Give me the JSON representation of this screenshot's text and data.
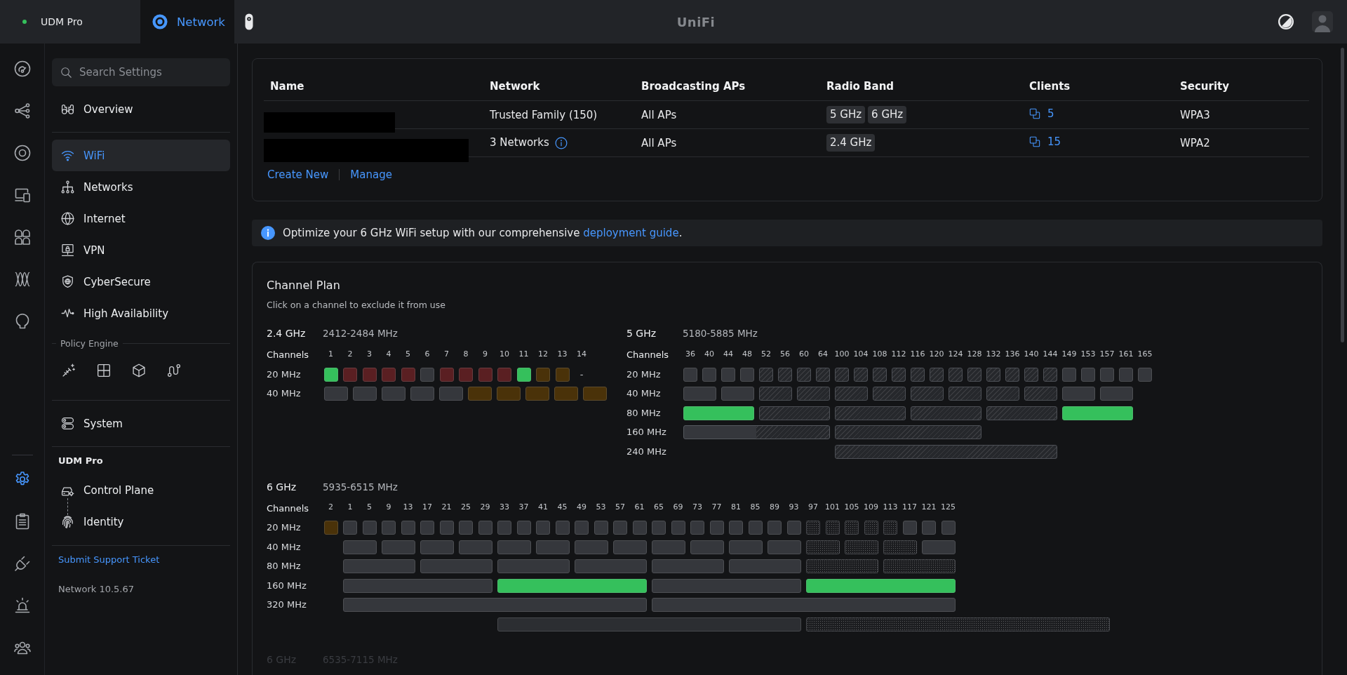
{
  "topbar": {
    "tabs": [
      {
        "kind": "device",
        "label": "UDM Pro",
        "selected": false
      },
      {
        "kind": "app",
        "label": "Network",
        "selected": true
      }
    ],
    "logo": "UniFi"
  },
  "rail": {
    "top": [
      {
        "selected": false
      },
      {
        "selected": false
      },
      {
        "selected": false
      },
      {
        "selected": false
      },
      {
        "selected": false
      },
      {
        "selected": false
      },
      {
        "selected": false
      }
    ],
    "bottom": [
      {
        "selected": true
      },
      {
        "selected": false
      },
      {
        "selected": false
      },
      {
        "selected": false
      },
      {
        "selected": false
      }
    ]
  },
  "sidebar": {
    "search": {
      "placeholder": "Search Settings"
    },
    "sections": [
      {
        "kind": "nav",
        "items": [
          {
            "label": "Overview",
            "selected": false
          }
        ]
      },
      {
        "kind": "nav",
        "items": [
          {
            "label": "WiFi",
            "selected": true
          },
          {
            "label": "Networks",
            "selected": false
          },
          {
            "label": "Internet",
            "selected": false
          },
          {
            "label": "VPN",
            "selected": false
          },
          {
            "label": "CyberSecure",
            "selected": false
          },
          {
            "label": "High Availability",
            "selected": false
          }
        ]
      },
      {
        "kind": "tools",
        "title": "Policy Engine",
        "tools": [
          {
            "selected": false
          },
          {
            "selected": false
          },
          {
            "selected": false
          },
          {
            "selected": false
          }
        ]
      },
      {
        "kind": "nav",
        "items": [
          {
            "label": "System",
            "selected": false
          }
        ]
      },
      {
        "kind": "device",
        "title": "UDM Pro",
        "items": [
          {
            "label": "Control Plane",
            "selected": false
          },
          {
            "label": "Identity",
            "selected": false
          }
        ]
      }
    ],
    "support_link": "Submit Support Ticket",
    "version": "Network 10.5.67"
  },
  "wifi_networks": {
    "columns": [
      "Name",
      "Network",
      "Broadcasting APs",
      "Radio Band",
      "Clients",
      "Security"
    ],
    "rows": [
      {
        "redacted": true,
        "network": "Trusted Family (150)",
        "info": false,
        "broadcasting_aps": "All APs",
        "radio_bands": [
          "5 GHz",
          "6 GHz"
        ],
        "clients": "5",
        "security": "WPA3"
      },
      {
        "redacted": true,
        "network": "3 Networks",
        "info": true,
        "broadcasting_aps": "All APs",
        "radio_bands": [
          "2.4 GHz"
        ],
        "clients": "15",
        "security": "WPA2"
      }
    ],
    "actions": [
      "Create New",
      "Manage"
    ]
  },
  "banner": {
    "text": "Optimize your 6 GHz WiFi setup with our comprehensive ",
    "link": "deployment guide",
    "tail": "."
  },
  "channel_plan": {
    "title": "Channel Plan",
    "subtitle": "Click on a channel to exclude it from use",
    "bands": [
      {
        "name": "2.4 GHz",
        "range": "2412-2484 MHz",
        "dimmed": false,
        "channels_label": "Channels",
        "channels": [
          "1",
          "2",
          "3",
          "4",
          "5",
          "6",
          "7",
          "8",
          "9",
          "10",
          "11",
          "12",
          "13",
          "14"
        ],
        "rows": [
          {
            "label": "20 MHz",
            "cells": [
              {
                "kind": "plain",
                "color": "#35c05c"
              },
              {
                "kind": "plain",
                "color": "#5a1f22"
              },
              {
                "kind": "plain",
                "color": "#5a1f22"
              },
              {
                "kind": "plain",
                "color": "#5a1f22"
              },
              {
                "kind": "plain",
                "color": "#5a1f22"
              },
              {
                "kind": "plain",
                "color": "#35373c"
              },
              {
                "kind": "plain",
                "color": "#5a1f22"
              },
              {
                "kind": "plain",
                "color": "#5a1f22"
              },
              {
                "kind": "plain",
                "color": "#5a1f22"
              },
              {
                "kind": "plain",
                "color": "#5a1f22"
              },
              {
                "kind": "plain",
                "color": "#35c05c"
              },
              {
                "kind": "plain",
                "color": "#4a3209"
              },
              {
                "kind": "plain",
                "color": "#4a3209"
              },
              {
                "kind": "text",
                "text": "-"
              }
            ]
          },
          {
            "label": "40 MHz",
            "cells": [
              {
                "kind": "plain",
                "color": "#35373c"
              },
              {
                "kind": "plain",
                "color": "#35373c"
              },
              {
                "kind": "plain",
                "color": "#35373c"
              },
              {
                "kind": "plain",
                "color": "#35373c"
              },
              {
                "kind": "plain",
                "color": "#35373c"
              },
              {
                "kind": "plain",
                "color": "#4a3209"
              },
              {
                "kind": "plain",
                "color": "#4a3209"
              },
              {
                "kind": "plain",
                "color": "#4a3209"
              },
              {
                "kind": "plain",
                "color": "#4a3209"
              },
              {
                "kind": "plain",
                "color": "#4a3209"
              }
            ]
          }
        ]
      },
      {
        "name": "5 GHz",
        "range": "5180-5885 MHz",
        "dimmed": false,
        "channels_label": "Channels",
        "channels": [
          "36",
          "40",
          "44",
          "48",
          "52",
          "56",
          "60",
          "64",
          "100",
          "104",
          "108",
          "112",
          "116",
          "120",
          "124",
          "128",
          "132",
          "136",
          "140",
          "144",
          "149",
          "153",
          "157",
          "161",
          "165"
        ],
        "rows": [
          {
            "label": "20 MHz",
            "cells": [
              {
                "kind": "plain",
                "color": "#35373c"
              },
              {
                "kind": "plain",
                "color": "#35373c"
              },
              {
                "kind": "plain",
                "color": "#35373c"
              },
              {
                "kind": "plain",
                "color": "#35373c"
              },
              {
                "kind": "hatched",
                "color": "#26282c"
              },
              {
                "kind": "hatched",
                "color": "#26282c"
              },
              {
                "kind": "hatched",
                "color": "#26282c"
              },
              {
                "kind": "hatched",
                "color": "#26282c"
              },
              {
                "kind": "hatched",
                "color": "#26282c"
              },
              {
                "kind": "hatched",
                "color": "#26282c"
              },
              {
                "kind": "hatched",
                "color": "#26282c"
              },
              {
                "kind": "hatched",
                "color": "#26282c"
              },
              {
                "kind": "hatched",
                "color": "#26282c"
              },
              {
                "kind": "hatched",
                "color": "#26282c"
              },
              {
                "kind": "hatched",
                "color": "#26282c"
              },
              {
                "kind": "hatched",
                "color": "#26282c"
              },
              {
                "kind": "hatched",
                "color": "#26282c"
              },
              {
                "kind": "hatched",
                "color": "#26282c"
              },
              {
                "kind": "hatched",
                "color": "#26282c"
              },
              {
                "kind": "hatched",
                "color": "#26282c"
              },
              {
                "kind": "plain",
                "color": "#35373c"
              },
              {
                "kind": "plain",
                "color": "#35373c"
              },
              {
                "kind": "plain",
                "color": "#35373c"
              },
              {
                "kind": "plain",
                "color": "#35373c"
              },
              {
                "kind": "plain",
                "color": "#35373c"
              }
            ]
          },
          {
            "label": "40 MHz",
            "cells": [
              {
                "kind": "plain",
                "color": "#35373c"
              },
              {
                "kind": "plain",
                "color": "#35373c"
              },
              {
                "kind": "hatched",
                "color": "#26282c"
              },
              {
                "kind": "hatched",
                "color": "#26282c"
              },
              {
                "kind": "hatched",
                "color": "#26282c"
              },
              {
                "kind": "hatched",
                "color": "#26282c"
              },
              {
                "kind": "hatched",
                "color": "#26282c"
              },
              {
                "kind": "hatched",
                "color": "#26282c"
              },
              {
                "kind": "hatched",
                "color": "#26282c"
              },
              {
                "kind": "hatched",
                "color": "#26282c"
              },
              {
                "kind": "plain",
                "color": "#35373c"
              },
              {
                "kind": "plain",
                "color": "#35373c"
              }
            ]
          },
          {
            "label": "80 MHz",
            "cells": [
              {
                "kind": "plain",
                "color": "#35c05c"
              },
              {
                "kind": "hatched",
                "color": "#26282c"
              },
              {
                "kind": "hatched",
                "color": "#26282c"
              },
              {
                "kind": "hatched",
                "color": "#26282c"
              },
              {
                "kind": "hatched",
                "color": "#26282c"
              },
              {
                "kind": "plain",
                "color": "#35c05c"
              }
            ]
          },
          {
            "label": "160 MHz",
            "cells": [
              {
                "kind": "split",
                "color": "#26282c"
              },
              {
                "kind": "hatched",
                "color": "#26282c"
              }
            ]
          },
          {
            "label": "240 MHz",
            "cells": [
              {
                "kind": "hatched",
                "color": "#26282c"
              }
            ]
          }
        ]
      },
      {
        "name": "6 GHz",
        "range": "5935-6515 MHz",
        "dimmed": false,
        "channels_label": "Channels",
        "channels": [
          "2",
          "1",
          "5",
          "9",
          "13",
          "17",
          "21",
          "25",
          "29",
          "33",
          "37",
          "41",
          "45",
          "49",
          "53",
          "57",
          "61",
          "65",
          "69",
          "73",
          "77",
          "81",
          "85",
          "89",
          "93",
          "97",
          "101",
          "105",
          "109",
          "113",
          "117",
          "121",
          "125"
        ],
        "rows": [
          {
            "label": "20 MHz",
            "cells": [
              {
                "kind": "plain",
                "color": "#4a3209"
              },
              {
                "kind": "plain",
                "color": "#35373c"
              },
              {
                "kind": "plain",
                "color": "#35373c"
              },
              {
                "kind": "plain",
                "color": "#35373c"
              },
              {
                "kind": "plain",
                "color": "#35373c"
              },
              {
                "kind": "plain",
                "color": "#35373c"
              },
              {
                "kind": "plain",
                "color": "#35373c"
              },
              {
                "kind": "plain",
                "color": "#35373c"
              },
              {
                "kind": "plain",
                "color": "#35373c"
              },
              {
                "kind": "plain",
                "color": "#35373c"
              },
              {
                "kind": "plain",
                "color": "#35373c"
              },
              {
                "kind": "plain",
                "color": "#35373c"
              },
              {
                "kind": "plain",
                "color": "#35373c"
              },
              {
                "kind": "plain",
                "color": "#35373c"
              },
              {
                "kind": "plain",
                "color": "#35373c"
              },
              {
                "kind": "plain",
                "color": "#35373c"
              },
              {
                "kind": "plain",
                "color": "#35373c"
              },
              {
                "kind": "plain",
                "color": "#35373c"
              },
              {
                "kind": "plain",
                "color": "#35373c"
              },
              {
                "kind": "plain",
                "color": "#35373c"
              },
              {
                "kind": "plain",
                "color": "#35373c"
              },
              {
                "kind": "plain",
                "color": "#35373c"
              },
              {
                "kind": "plain",
                "color": "#35373c"
              },
              {
                "kind": "plain",
                "color": "#35373c"
              },
              {
                "kind": "plain",
                "color": "#35373c"
              },
              {
                "kind": "dotted",
                "color": "#1c1d20"
              },
              {
                "kind": "dotted",
                "color": "#1c1d20"
              },
              {
                "kind": "dotted",
                "color": "#1c1d20"
              },
              {
                "kind": "dotted",
                "color": "#1c1d20"
              },
              {
                "kind": "dotted",
                "color": "#1c1d20"
              },
              {
                "kind": "plain",
                "color": "#35373c"
              },
              {
                "kind": "plain",
                "color": "#35373c"
              },
              {
                "kind": "plain",
                "color": "#35373c"
              }
            ]
          },
          {
            "label": "40 MHz",
            "cells": [
              {
                "kind": "plain",
                "color": "#35373c"
              },
              {
                "kind": "plain",
                "color": "#35373c"
              },
              {
                "kind": "plain",
                "color": "#35373c"
              },
              {
                "kind": "plain",
                "color": "#35373c"
              },
              {
                "kind": "plain",
                "color": "#35373c"
              },
              {
                "kind": "plain",
                "color": "#35373c"
              },
              {
                "kind": "plain",
                "color": "#35373c"
              },
              {
                "kind": "plain",
                "color": "#35373c"
              },
              {
                "kind": "plain",
                "color": "#35373c"
              },
              {
                "kind": "plain",
                "color": "#35373c"
              },
              {
                "kind": "plain",
                "color": "#35373c"
              },
              {
                "kind": "plain",
                "color": "#35373c"
              },
              {
                "kind": "dotted",
                "color": "#1c1d20"
              },
              {
                "kind": "dotted",
                "color": "#1c1d20"
              },
              {
                "kind": "dotted",
                "color": "#1c1d20"
              },
              {
                "kind": "plain",
                "color": "#35373c"
              }
            ]
          },
          {
            "label": "80 MHz",
            "cells": [
              {
                "kind": "plain",
                "color": "#35373c"
              },
              {
                "kind": "plain",
                "color": "#35373c"
              },
              {
                "kind": "plain",
                "color": "#35373c"
              },
              {
                "kind": "plain",
                "color": "#35373c"
              },
              {
                "kind": "plain",
                "color": "#35373c"
              },
              {
                "kind": "plain",
                "color": "#35373c"
              },
              {
                "kind": "dotted",
                "color": "#1c1d20"
              },
              {
                "kind": "dotted",
                "color": "#1c1d20"
              }
            ]
          },
          {
            "label": "160 MHz",
            "cells": [
              {
                "kind": "plain",
                "color": "#35373c"
              },
              {
                "kind": "plain",
                "color": "#35c05c"
              },
              {
                "kind": "plain",
                "color": "#35373c"
              },
              {
                "kind": "plain",
                "color": "#35c05c"
              }
            ]
          },
          {
            "label": "320 MHz",
            "cells": [
              {
                "kind": "plain",
                "color": "#35373c"
              },
              {
                "kind": "plain",
                "color": "#35373c"
              }
            ]
          },
          {
            "cells": [
              {
                "kind": "plain",
                "color": "#2c2e32"
              },
              {
                "kind": "dotted",
                "color": "#1c1d20"
              }
            ]
          }
        ]
      },
      {
        "name": "6 GHz",
        "range": "6535-7115 MHz",
        "dimmed": true
      }
    ]
  }
}
